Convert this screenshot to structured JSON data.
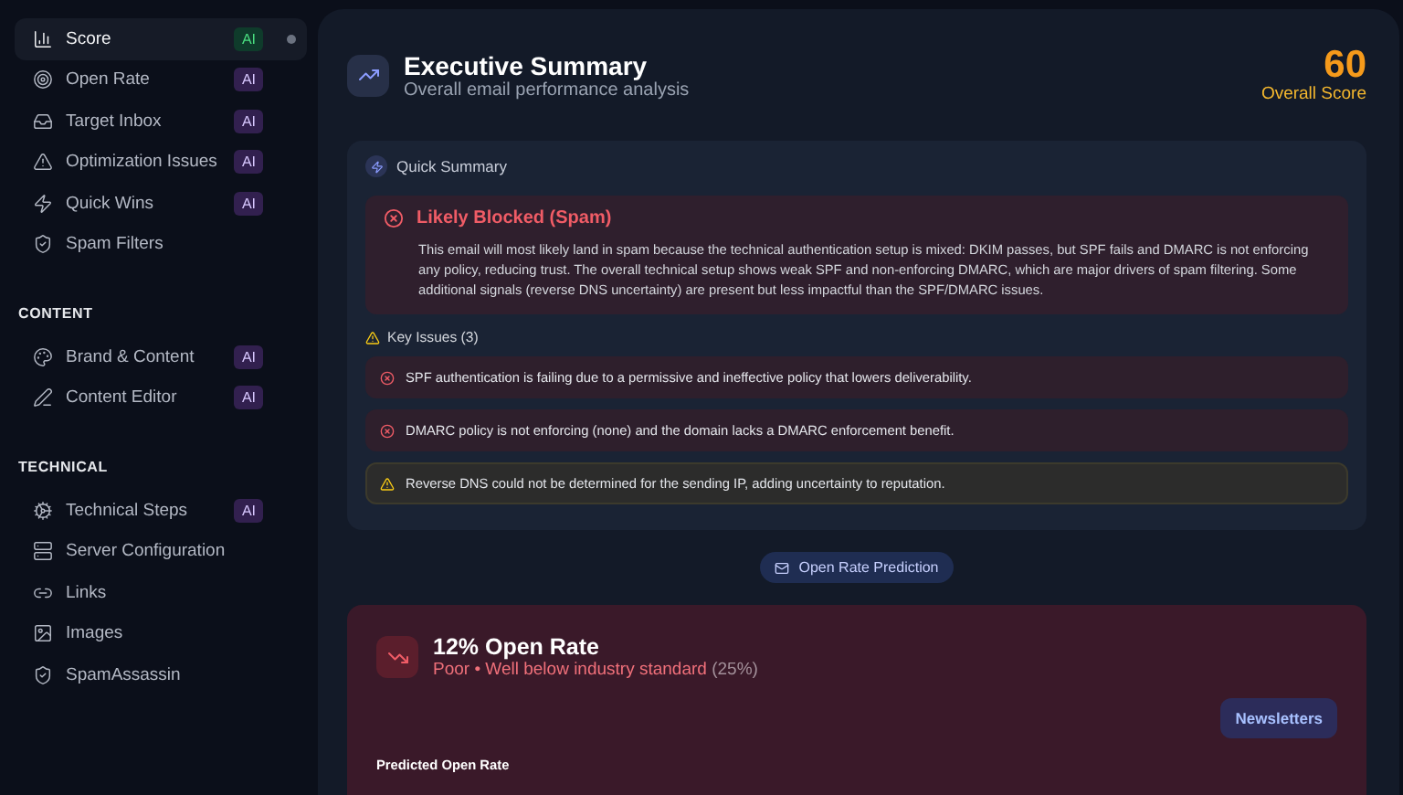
{
  "sidebar": {
    "groups": [
      {
        "items": [
          {
            "label": "Score",
            "badge": "AI",
            "selected": true
          },
          {
            "label": "Open Rate",
            "badge": "AI",
            "selected": false
          },
          {
            "label": "Target Inbox",
            "badge": "AI",
            "selected": false
          },
          {
            "label": "Optimization Issues",
            "badge": "AI",
            "selected": false
          },
          {
            "label": "Quick Wins",
            "badge": "AI",
            "selected": false
          },
          {
            "label": "Spam Filters",
            "selected": false
          }
        ]
      },
      {
        "heading": "CONTENT",
        "items": [
          {
            "label": "Brand & Content",
            "badge": "AI",
            "selected": false
          },
          {
            "label": "Content Editor",
            "badge": "AI",
            "selected": false
          }
        ]
      },
      {
        "heading": "TECHNICAL",
        "items": [
          {
            "label": "Technical Steps",
            "badge": "AI",
            "selected": false
          },
          {
            "label": "Server Configuration",
            "selected": false
          },
          {
            "label": "Links",
            "selected": false
          },
          {
            "label": "Images",
            "selected": false
          },
          {
            "label": "SpamAssassin",
            "selected": false
          }
        ]
      }
    ]
  },
  "summary": {
    "title": "Executive Summary",
    "subtitle": "Overall email performance analysis",
    "score": "60",
    "score_label": "Overall Score",
    "quick_summary": {
      "label": "Quick Summary",
      "verdict": "Likely Blocked (Spam)",
      "text": "This email will most likely land in spam because the technical authentication setup is mixed: DKIM passes, but SPF fails and DMARC is not enforcing any policy, reducing trust. The overall technical setup shows weak SPF and non-enforcing DMARC, which are major drivers of spam filtering. Some additional signals (reverse DNS uncertainty) are present but less impactful than the SPF/DMARC issues.",
      "issues_label": "Key Issues (3)",
      "issues": [
        {
          "kind": "error",
          "text": "SPF authentication is failing due to a permissive and ineffective policy that lowers deliverability."
        },
        {
          "kind": "error",
          "text": "DMARC policy is not enforcing (none) and the domain lacks a DMARC enforcement benefit."
        },
        {
          "kind": "warning",
          "text": "Reverse DNS could not be determined for the sending IP, adding uncertainty to reputation."
        }
      ]
    }
  },
  "open_rate": {
    "section_label": "Open Rate Prediction",
    "title": "12% Open Rate",
    "rating": "Poor • Well below industry standard",
    "benchmark": "(25%)",
    "category": "Newsletters",
    "predicted_label": "Predicted Open Rate"
  }
}
